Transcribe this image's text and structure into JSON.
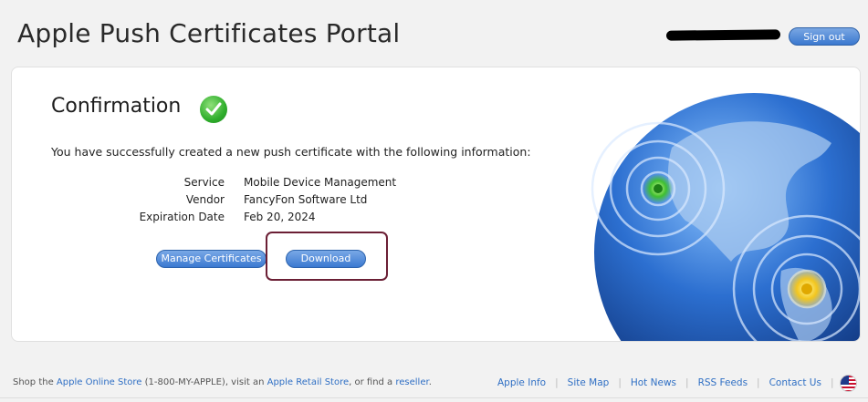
{
  "header": {
    "title": "Apple Push Certificates Portal",
    "signout_label": "Sign out"
  },
  "confirmation": {
    "heading": "Confirmation",
    "intro": "You have successfully created a new push certificate with the following information:",
    "details": [
      {
        "label": "Service",
        "value": "Mobile Device Management"
      },
      {
        "label": "Vendor",
        "value": "FancyFon Software Ltd"
      },
      {
        "label": "Expiration Date",
        "value": "Feb 20, 2024"
      }
    ],
    "manage_label": "Manage Certificates",
    "download_label": "Download"
  },
  "footer": {
    "shop_prefix": "Shop the ",
    "store_link": "Apple Online Store",
    "phone": " (1-800-MY-APPLE), visit an ",
    "retail_link": "Apple Retail Store",
    "or_find": ", or find a ",
    "reseller_link": "reseller",
    "period": ".",
    "links": [
      "Apple Info",
      "Site Map",
      "Hot News",
      "RSS Feeds",
      "Contact Us"
    ]
  },
  "colors": {
    "accent": "#3b79d1",
    "highlight_box": "#6b1f35",
    "check": "#2fae2c"
  },
  "icons": [
    "checkmark-icon",
    "globe-image",
    "us-flag-icon"
  ]
}
